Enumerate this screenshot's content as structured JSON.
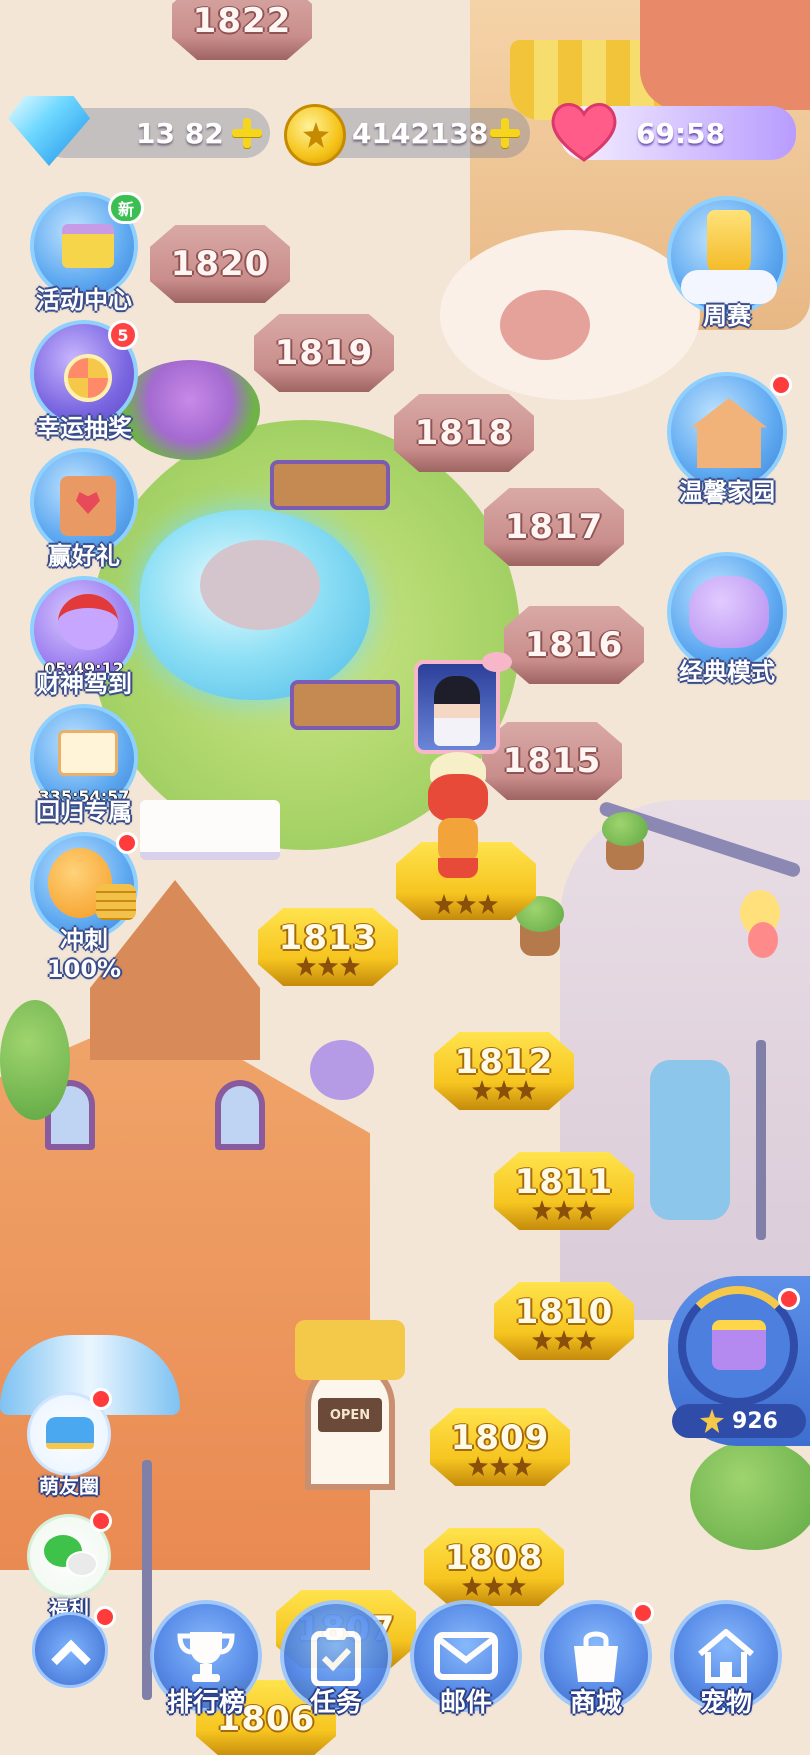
{
  "currency": {
    "diamonds": "13 82",
    "coins": "4142138",
    "lives_timer": "69:58"
  },
  "left_menu": {
    "activity_center": {
      "label": "活动中心",
      "badge": "新"
    },
    "lucky_draw": {
      "label": "幸运抽奖",
      "badge": "5"
    },
    "win_gift": {
      "label": "赢好礼"
    },
    "god_of_wealth": {
      "label": "财神驾到",
      "timer": "05:49:12"
    },
    "return_exclusive": {
      "label": "回归专属",
      "timer": "335:54:57"
    },
    "sprint": {
      "label": "冲刺100%"
    },
    "friends_circle": {
      "label": "萌友圈"
    },
    "welfare": {
      "label": "福利"
    }
  },
  "right_menu": {
    "weekly": {
      "label": "周赛"
    },
    "home": {
      "label": "温馨家园"
    },
    "classic": {
      "label": "经典模式"
    },
    "star_chest": {
      "count": "926"
    }
  },
  "levels_locked": [
    "1822",
    "1820",
    "1819",
    "1818",
    "1817",
    "1816",
    "1815"
  ],
  "levels_done": [
    "1813",
    "1812",
    "1811",
    "1810",
    "1809",
    "1808",
    "1807",
    "1806"
  ],
  "current_level_stars": 3,
  "bottom_nav": {
    "ranking": "排行榜",
    "tasks": "任务",
    "mail": "邮件",
    "shop": "商城",
    "pets": "宠物"
  },
  "scenery": {
    "door_sign": "OPEN"
  },
  "colors": {
    "gold": "#f6c520",
    "locked": "#c98e8b",
    "nav_blue": "#4d86ea",
    "red_dot": "#ff3b3b"
  }
}
